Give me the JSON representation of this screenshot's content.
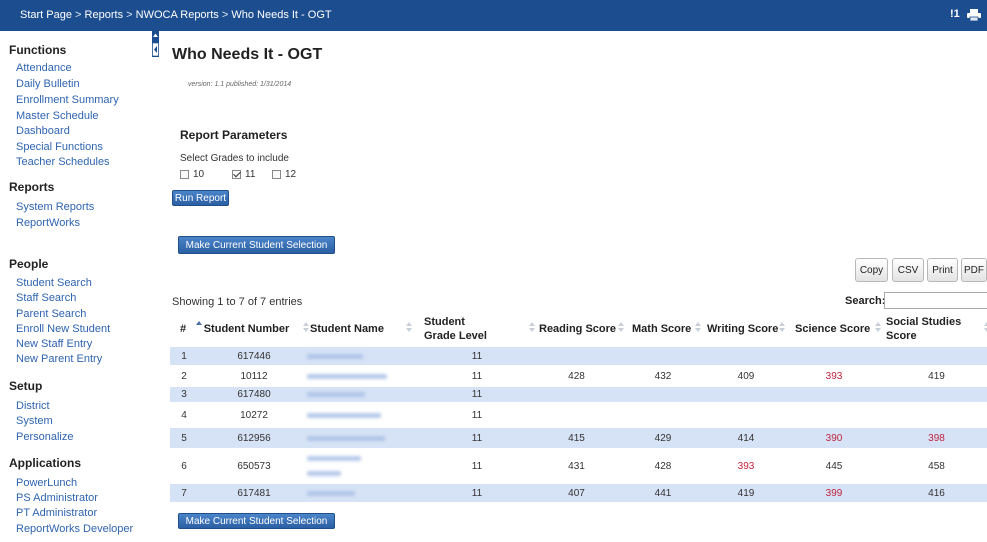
{
  "breadcrumb": {
    "items": [
      "Start Page",
      "Reports",
      "NWOCA Reports"
    ],
    "separator": ">",
    "current": "Who Needs It - OGT"
  },
  "header": {
    "alert_count": "!1",
    "print_icon": "printer-icon"
  },
  "sidebar": {
    "functions": {
      "title": "Functions",
      "items": [
        "Attendance",
        "Daily Bulletin",
        "Enrollment Summary",
        "Master Schedule",
        "Dashboard",
        "Special Functions",
        "Teacher Schedules"
      ]
    },
    "reports": {
      "title": "Reports",
      "items": [
        "System Reports",
        "ReportWorks"
      ]
    },
    "people": {
      "title": "People",
      "items": [
        "Student Search",
        "Staff Search",
        "Parent Search",
        "Enroll New Student",
        "New Staff Entry",
        "New Parent Entry"
      ]
    },
    "setup": {
      "title": "Setup",
      "items": [
        "District",
        "System",
        "Personalize"
      ]
    },
    "applications": {
      "title": "Applications",
      "items": [
        "PowerLunch",
        "PS Administrator",
        "PT Administrator",
        "ReportWorks Developer"
      ]
    }
  },
  "page": {
    "title": "Who Needs It - OGT",
    "version_note": "version: 1.1 published: 1/31/2014",
    "params_title": "Report Parameters",
    "grades_label": "Select Grades to include",
    "grades": [
      {
        "label": "10",
        "checked": false
      },
      {
        "label": "11",
        "checked": true
      },
      {
        "label": "12",
        "checked": false
      }
    ],
    "run_button": "Run Report",
    "selection_button": "Make Current Student Selection"
  },
  "export_buttons": [
    "Copy",
    "CSV",
    "Print",
    "PDF"
  ],
  "table": {
    "info": "Showing 1 to 7 of 7 entries",
    "search_label": "Search:",
    "search_value": "",
    "columns": [
      "#",
      "Student Number",
      "Student Name",
      "Student Grade Level",
      "Reading Score",
      "Math Score",
      "Writing Score",
      "Science Score",
      "Social Studies Score"
    ],
    "low_score_color": "#c0243e",
    "highlight_color": "#d6e2f5",
    "rows": [
      {
        "num": "1",
        "student_number": "617446",
        "grade": "11",
        "reading": "",
        "math": "",
        "writing": "",
        "science": "",
        "social": "",
        "low": []
      },
      {
        "num": "2",
        "student_number": "10112",
        "grade": "11",
        "reading": "428",
        "math": "432",
        "writing": "409",
        "science": "393",
        "social": "419",
        "low": [
          "science"
        ]
      },
      {
        "num": "3",
        "student_number": "617480",
        "grade": "11",
        "reading": "",
        "math": "",
        "writing": "",
        "science": "",
        "social": "",
        "low": []
      },
      {
        "num": "4",
        "student_number": "10272",
        "grade": "11",
        "reading": "",
        "math": "",
        "writing": "",
        "science": "",
        "social": "",
        "low": []
      },
      {
        "num": "5",
        "student_number": "612956",
        "grade": "11",
        "reading": "415",
        "math": "429",
        "writing": "414",
        "science": "390",
        "social": "398",
        "low": [
          "science",
          "social"
        ]
      },
      {
        "num": "6",
        "student_number": "650573",
        "grade": "11",
        "reading": "431",
        "math": "428",
        "writing": "393",
        "science": "445",
        "social": "458",
        "low": [
          "writing"
        ]
      },
      {
        "num": "7",
        "student_number": "617481",
        "grade": "11",
        "reading": "407",
        "math": "441",
        "writing": "419",
        "science": "399",
        "social": "416",
        "low": [
          "science"
        ]
      }
    ]
  }
}
